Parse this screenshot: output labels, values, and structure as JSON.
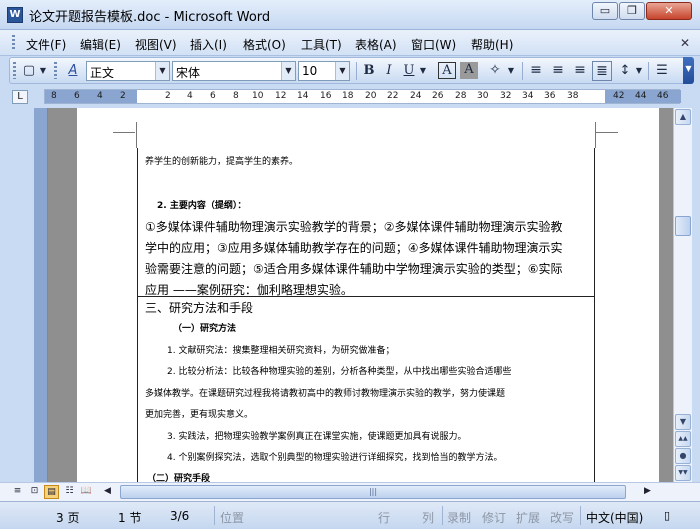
{
  "window": {
    "title": "论文开题报告模板.doc - Microsoft Word",
    "icon_name": "word-app-icon",
    "controls": {
      "minimize": "▭",
      "maximize": "❐",
      "close": "✕"
    }
  },
  "menu": {
    "items": [
      "文件(F)",
      "编辑(E)",
      "视图(V)",
      "插入(I)",
      "格式(O)",
      "工具(T)",
      "表格(A)",
      "窗口(W)",
      "帮助(H)"
    ]
  },
  "toolbar": {
    "style_value": "正文",
    "font_value": "宋体",
    "size_value": "10",
    "buttons": {
      "bold": "B",
      "italic": "I",
      "underline": "U",
      "char_border": "A",
      "char_shading": "A",
      "new_doc": "▢",
      "styles": "A"
    }
  },
  "ruler": {
    "ticks": [
      "8",
      "6",
      "4",
      "2",
      "2",
      "4",
      "6",
      "8",
      "10",
      "12",
      "14",
      "16",
      "18",
      "20",
      "22",
      "24",
      "26",
      "28",
      "30",
      "32",
      "34",
      "36",
      "38",
      "42",
      "44",
      "46"
    ],
    "tab_selector": "L"
  },
  "document": {
    "lines": [
      "养学生的创新能力，提高学生的素养。",
      "2. 主要内容（提纲）：",
      "①多媒体课件辅助物理演示实验教学的背景；②多媒体课件辅助物理演示实验教",
      "学中的应用；③应用多媒体辅助教学存在的问题；④多媒体课件辅助物理演示实",
      "验需要注意的问题；⑤适合用多媒体课件辅助中学物理演示实验的类型；⑥实际",
      "应用 ——案例研究：伽利略理想实验。",
      "三、研究方法和手段",
      "（一）研究方法",
      "1. 文献研究法：搜集整理相关研究资料，为研究做准备；",
      "2. 比较分析法：比较各种物理实验的差别，分析各种类型，从中找出哪些实验合适哪些",
      "多媒体教学。在课题研究过程我将请教初高中的教师讨教物理演示实验的教学，努力使课题",
      "更加完善，更有现实意义。",
      "3. 实践法，把物理实验教学案例真正在课堂实施，使课题更加具有说服力。",
      "4. 个别案例探究法，选取个别典型的物理实验进行详细探究，找到恰当的教学方法。",
      "（二）研究手段"
    ]
  },
  "scrollbar": {
    "up": "▲",
    "down": "▼",
    "prev_page": "▲▲",
    "select_object": "●",
    "next_page": "▼▼",
    "left": "◀",
    "right": "▶",
    "thumb_grip": "|||"
  },
  "status": {
    "page": "3 页",
    "section": "1 节",
    "page_of": "3/6",
    "position": "位置",
    "line": "行",
    "col": "列",
    "rec": "录制",
    "trk": "修订",
    "ext": "扩展",
    "ovr": "改写",
    "language": "中文(中国)"
  }
}
